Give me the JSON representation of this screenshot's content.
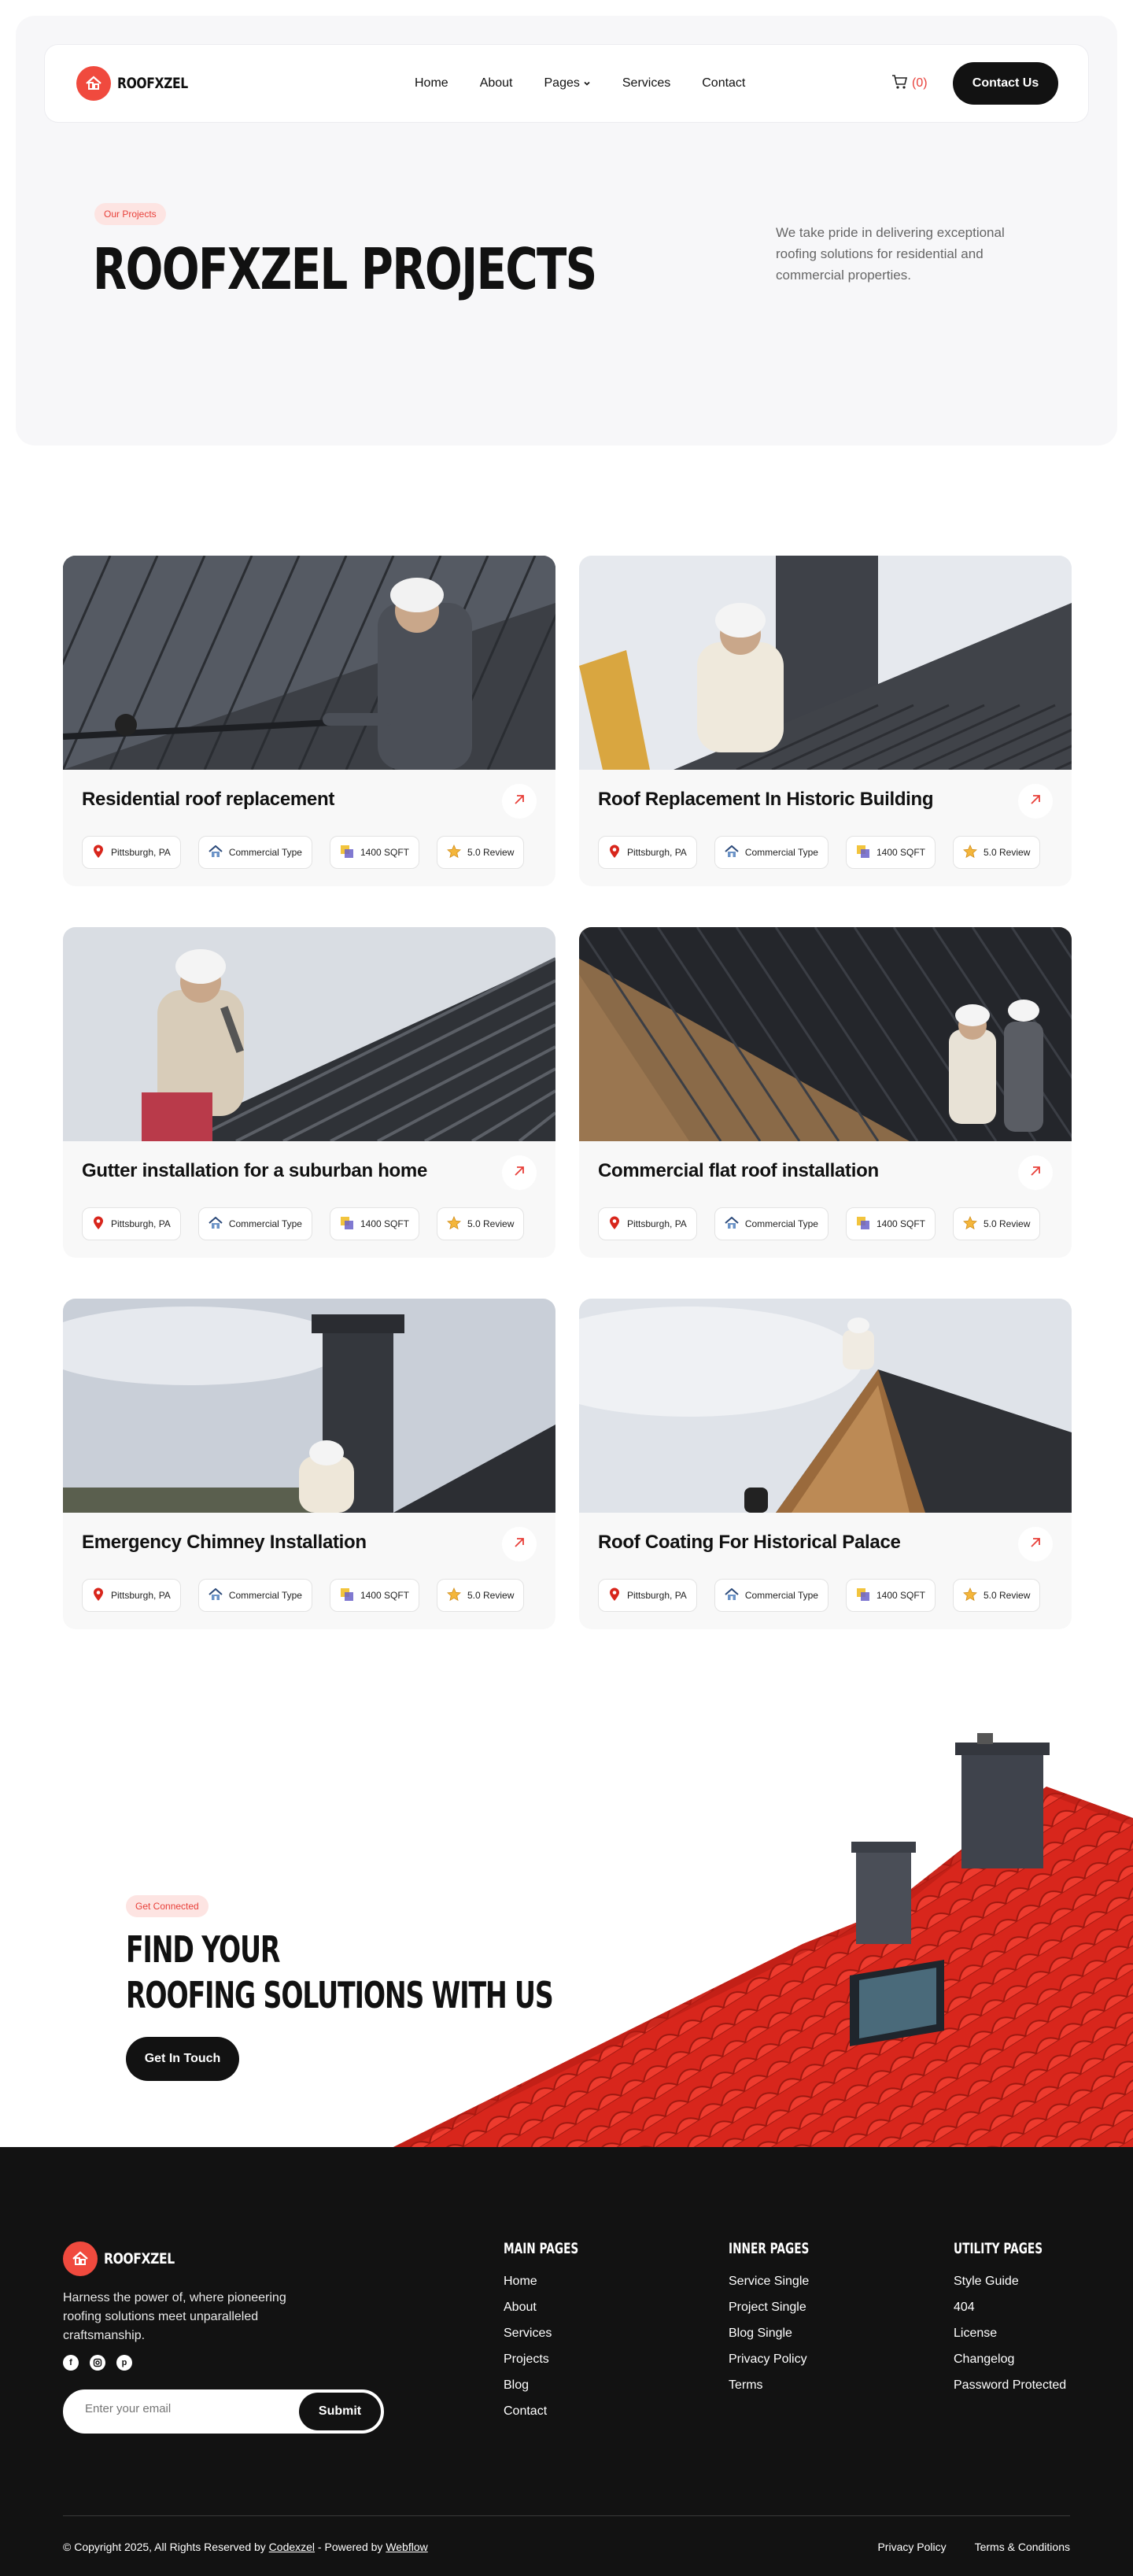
{
  "brand": {
    "name": "ROOFXZEL",
    "accent": "#f04a3e",
    "dark": "#121212"
  },
  "nav": {
    "items": [
      {
        "label": "Home"
      },
      {
        "label": "About"
      },
      {
        "label": "Pages"
      },
      {
        "label": "Services"
      },
      {
        "label": "Contact"
      }
    ],
    "cart_count": "(0)",
    "cta_label": "Contact Us"
  },
  "hero": {
    "pill": "Our Projects",
    "title": "ROOFXZEL PROJECTS",
    "description": "We take pride in delivering exceptional roofing solutions for residential and commercial properties."
  },
  "projects": [
    {
      "title": "Residential roof replacement",
      "location": "Pittsburgh, PA",
      "type": "Commercial Type",
      "area": "1400 SQFT",
      "review": "5.0 Review",
      "image": "worker-on-dark-roof"
    },
    {
      "title": "Roof Replacement In Historic Building",
      "location": "Pittsburgh, PA",
      "type": "Commercial Type",
      "area": "1400 SQFT",
      "review": "5.0 Review",
      "image": "worker-near-chimney"
    },
    {
      "title": "Gutter installation for a suburban home",
      "location": "Pittsburgh, PA",
      "type": "Commercial Type",
      "area": "1400 SQFT",
      "review": "5.0 Review",
      "image": "worker-with-hammer"
    },
    {
      "title": "Commercial flat roof installation",
      "location": "Pittsburgh, PA",
      "type": "Commercial Type",
      "area": "1400 SQFT",
      "review": "5.0 Review",
      "image": "two-workers-metal-roof"
    },
    {
      "title": "Emergency Chimney Installation",
      "location": "Pittsburgh, PA",
      "type": "Commercial Type",
      "area": "1400 SQFT",
      "review": "5.0 Review",
      "image": "chimney-and-worker"
    },
    {
      "title": "Roof Coating For Historical Palace",
      "location": "Pittsburgh, PA",
      "type": "Commercial Type",
      "area": "1400 SQFT",
      "review": "5.0 Review",
      "image": "worker-on-roof-peak"
    }
  ],
  "cta": {
    "pill": "Get Connected",
    "title_line1": "FIND YOUR",
    "title_line2": "ROOFING SOLUTIONS WITH US",
    "button": "Get In Touch"
  },
  "footer": {
    "description": "Harness the power of, where pioneering roofing solutions meet unparalleled craftsmanship.",
    "email_placeholder": "Enter your email",
    "submit_label": "Submit",
    "socials": [
      "facebook-icon",
      "instagram-icon",
      "pinterest-icon"
    ],
    "columns": [
      {
        "heading": "MAIN PAGES",
        "links": [
          "Home",
          "About",
          "Services",
          "Projects",
          "Blog",
          "Contact"
        ]
      },
      {
        "heading": "INNER PAGES",
        "links": [
          "Service Single",
          "Project Single",
          "Blog Single",
          "Privacy Policy",
          "Terms"
        ]
      },
      {
        "heading": "UTILITY PAGES",
        "links": [
          "Style Guide",
          "404",
          "License",
          "Changelog",
          "Password Protected"
        ]
      }
    ],
    "copyright_prefix": "© Copyright 2025, All Rights Reserved by ",
    "copyright_link1": "Codexzel",
    "copyright_mid": " - Powered by ",
    "copyright_link2": "Webflow",
    "legal": [
      "Privacy Policy",
      "Terms & Conditions"
    ]
  }
}
